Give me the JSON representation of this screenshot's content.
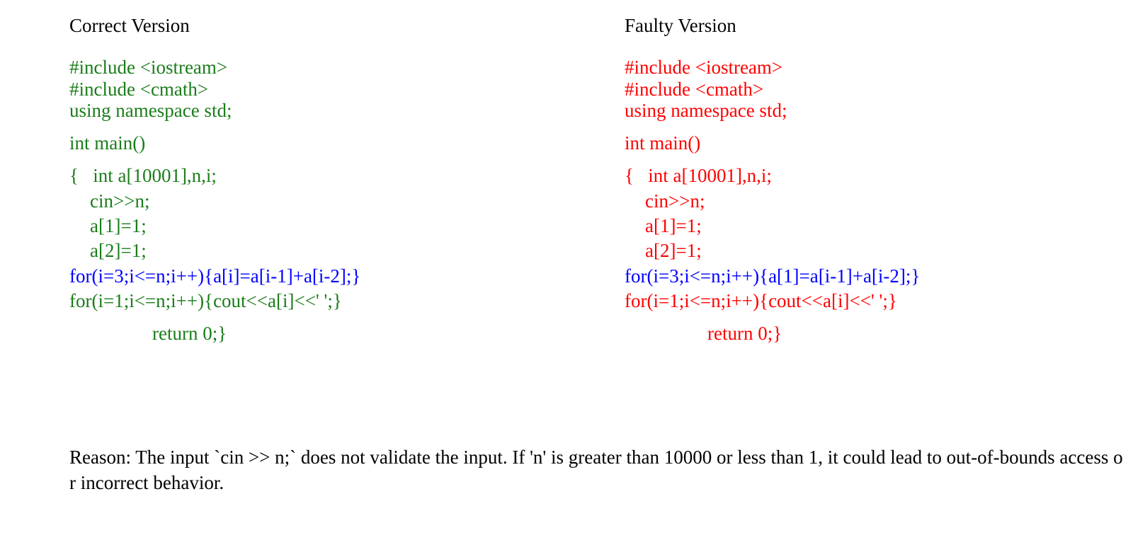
{
  "correct": {
    "title": "Correct Version",
    "lines": [
      "#include <iostream>",
      "#include <cmath>",
      "using namespace std;",
      "int main()",
      "{   int a[10001],n,i;",
      "cin>>n;",
      "a[1]=1;",
      "a[2]=1;",
      "for(i=3;i<=n;i++){a[i]=a[i-1]+a[i-2];}",
      "for(i=1;i<=n;i++){cout<<a[i]<<' ';}",
      "return 0;}"
    ]
  },
  "faulty": {
    "title": "Faulty Version",
    "lines": [
      "#include <iostream>",
      "#include <cmath>",
      "using namespace std;",
      "int main()",
      "{   int a[10001],n,i;",
      "cin>>n;",
      "a[1]=1;",
      "a[2]=1;",
      "for(i=3;i<=n;i++){a[1]=a[i-1]+a[i-2];}",
      "for(i=1;i<=n;i++){cout<<a[i]<<' ';}",
      "return 0;}"
    ]
  },
  "reason": "Reason: The input `cin >> n;` does not validate the input. If 'n' is greater than 10000 or less than 1, it could lead to out-of-bounds access or incorrect behavior.",
  "colors": {
    "correct_code": "#1a7d1a",
    "faulty_code": "#ff0000",
    "highlight_line": "#0000ff"
  }
}
